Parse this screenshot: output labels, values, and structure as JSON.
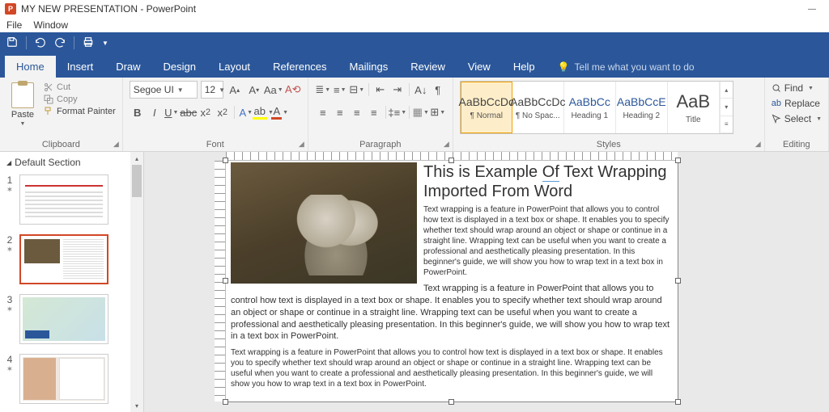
{
  "titlebar": {
    "app_initial": "P",
    "title": "MY NEW PRESENTATION - PowerPoint"
  },
  "menubar": {
    "file": "File",
    "window": "Window"
  },
  "tabs": {
    "home": "Home",
    "insert": "Insert",
    "draw": "Draw",
    "design": "Design",
    "layout": "Layout",
    "references": "References",
    "mailings": "Mailings",
    "review": "Review",
    "view": "View",
    "help": "Help",
    "tell_me": "Tell me what you want to do"
  },
  "ribbon": {
    "clipboard": {
      "paste": "Paste",
      "cut": "Cut",
      "copy": "Copy",
      "format_painter": "Format Painter",
      "label": "Clipboard"
    },
    "font": {
      "name": "Segoe UI",
      "size": "12",
      "label": "Font"
    },
    "paragraph": {
      "label": "Paragraph"
    },
    "styles": {
      "label": "Styles",
      "items": [
        {
          "preview": "AaBbCcDc",
          "name": "¶ Normal"
        },
        {
          "preview": "AaBbCcDc",
          "name": "¶ No Spac..."
        },
        {
          "preview": "AaBbCc",
          "name": "Heading 1"
        },
        {
          "preview": "AaBbCcE",
          "name": "Heading 2"
        },
        {
          "preview": "AaB",
          "name": "Title"
        }
      ]
    },
    "editing": {
      "find": "Find",
      "replace": "Replace",
      "select": "Select",
      "label": "Editing"
    }
  },
  "panel": {
    "section": "Default Section",
    "slides": [
      "1",
      "2",
      "3",
      "4"
    ]
  },
  "document": {
    "heading_a": "This is Example ",
    "heading_u1": "Of",
    "heading_b": " Text Wrapping ",
    "heading_c": "Imported From Word",
    "p1": "Text wrapping is a feature in PowerPoint that allows you to control how text is displayed in a text box or shape. It enables you to specify whether text should wrap around an object or shape or continue in a straight line. Wrapping text can be useful when you want to create a professional and aesthetically pleasing presentation. In this beginner's guide, we will show you how to wrap text in a text box in PowerPoint.",
    "p2": "Text wrapping is a feature in PowerPoint that allows you to control how text is displayed in a text box or shape. It enables you to specify whether text should wrap around an object or shape or continue in a straight line. Wrapping text can be useful when you want to create a professional and aesthetically pleasing presentation. In this beginner's guide, we will show you how to wrap text in a text box in PowerPoint.",
    "p3": "Text wrapping is a feature in PowerPoint that allows you to control how text is displayed in a text box or shape. It enables you to specify whether text should wrap around an object or shape or continue in a straight line. Wrapping text can be useful when you want to create a professional and aesthetically pleasing presentation. In this beginner's guide, we will show you how to wrap text in a text box in PowerPoint."
  }
}
